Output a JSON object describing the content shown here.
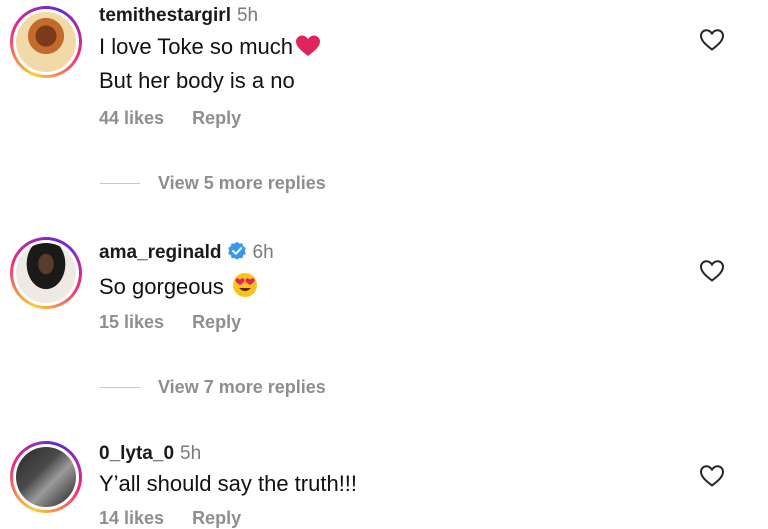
{
  "comments": [
    {
      "username": "temithestargirl",
      "time": "5h",
      "verified": false,
      "text_lines": [
        "I love Toke so much",
        "But her body is a no"
      ],
      "emoji": "red-heart",
      "likes": "44 likes",
      "reply_label": "Reply",
      "view_replies": "View 5 more replies"
    },
    {
      "username": "ama_reginald",
      "time": "6h",
      "verified": true,
      "text_lines": [
        "So gorgeous"
      ],
      "emoji": "heart-eyes",
      "likes": "15 likes",
      "reply_label": "Reply",
      "view_replies": "View 7 more replies"
    },
    {
      "username": "0_lyta_0",
      "time": "5h",
      "verified": false,
      "text_lines": [
        "Y’all should say the truth!!!"
      ],
      "likes": "14 likes",
      "reply_label": "Reply"
    }
  ],
  "icons": {
    "like": "heart-outline-icon",
    "verified": "verified-badge-icon"
  },
  "colors": {
    "verified_badge": "#3897f0",
    "muted_text": "#8e8e8e",
    "heart_emoji": "#e0245e"
  }
}
